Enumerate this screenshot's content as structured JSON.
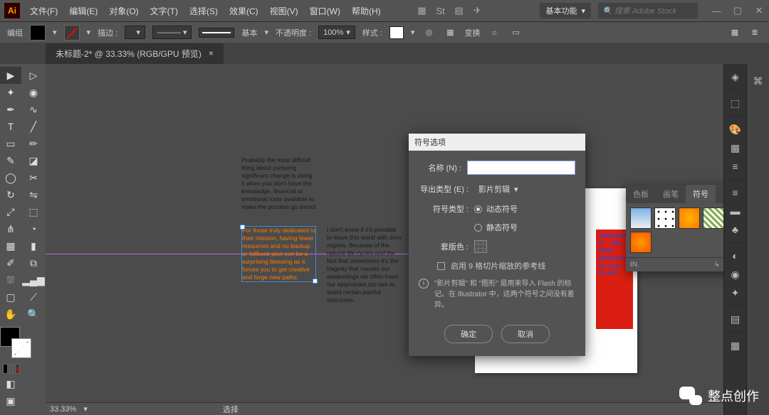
{
  "menubar": {
    "items": [
      "文件(F)",
      "编辑(E)",
      "对象(O)",
      "文字(T)",
      "选择(S)",
      "效果(C)",
      "视图(V)",
      "窗口(W)",
      "帮助(H)"
    ]
  },
  "workspace": {
    "label": "基本功能"
  },
  "search": {
    "placeholder": "搜索 Adobe Stock"
  },
  "optbar": {
    "edit": "编组",
    "strokeLabel": "描边 :",
    "basic": "基本",
    "opacityLabel": "不透明度 :",
    "opacityVal": "100%",
    "styleLabel": "样式 :",
    "transform": "变换"
  },
  "doc": {
    "tab": "未标题-2* @ 33.33% (RGB/GPU 预览)"
  },
  "canvas": {
    "t1": "Probably the most difficult thing about pursuing significant change is doing it when you don't have the knowledge, financial or emotional tools available to make the process go smoot",
    "t2": "For those truly dedicated to their mission, having fewer resources and no backup or fallback plan can be a surprising blessing as it forces you to get creative and forge new paths.",
    "t3": "I don't know if it's possible to leave this world with zero regrets. Because of the natural life cycles and the fact that sometimes it's the tragedy that causes our awakenings we often have our epiphanies too late to avoid certain painful outcomes.",
    "red": "dedicated to …ing fewer backup or be a sur- …ue and"
  },
  "dialog": {
    "title": "符号选项",
    "nameLabel": "名称 (N) :",
    "nameVal": "",
    "exportLabel": "导出类型 (E) :",
    "exportVal": "影片剪辑",
    "symTypeLabel": "符号类型 :",
    "radio1": "动态符号",
    "radio2": "静态符号",
    "regLabel": "套版色 :",
    "nineSlice": "启用 9 格切片缩放的参考线",
    "info": "\"影片剪辑\" 和 \"图形\" 是用来导入 Flash 的标记。在 Illustrator 中，这两个符号之间没有差异。",
    "ok": "确定",
    "cancel": "取消"
  },
  "panel": {
    "tabs": [
      "色板",
      "画笔",
      "符号"
    ],
    "foot": "IN."
  },
  "status": {
    "zoom": "33.33%",
    "sel": "选择"
  },
  "watermark": "整点创作"
}
